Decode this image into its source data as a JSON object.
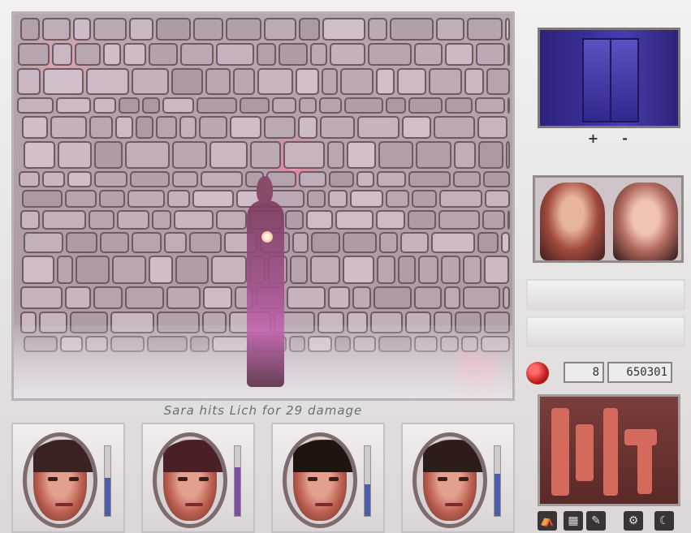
{
  "game": {
    "message": "Sara hits Lich for 29 damage",
    "party": [
      {
        "name_icon": "fighter-portrait",
        "hair": "#3b2220",
        "health": 0.55,
        "bar_color": "#4b5ea7"
      },
      {
        "name_icon": "mage-portrait",
        "hair": "#4a1f26",
        "health": 0.7,
        "bar_color": "#7b4fa0"
      },
      {
        "name_icon": "cleric-portrait",
        "hair": "#20140f",
        "health": 0.45,
        "bar_color": "#4b5ea7"
      },
      {
        "name_icon": "rogue-portrait",
        "hair": "#2d1d19",
        "health": 0.6,
        "bar_color": "#4b5ea7"
      }
    ],
    "zoom": {
      "plus": "+",
      "minus": "-"
    },
    "gold": {
      "left": "8",
      "right": "650301"
    },
    "emblem_colors": {
      "bg": "#5a2a28",
      "glyph": "#d46a5c"
    },
    "actions": [
      "camp-icon",
      "map-icon",
      "journal-icon",
      "options-icon",
      "rest-icon"
    ],
    "action_glyphs": [
      "⛺",
      "▦",
      "✎",
      "⚙",
      "☾"
    ]
  }
}
